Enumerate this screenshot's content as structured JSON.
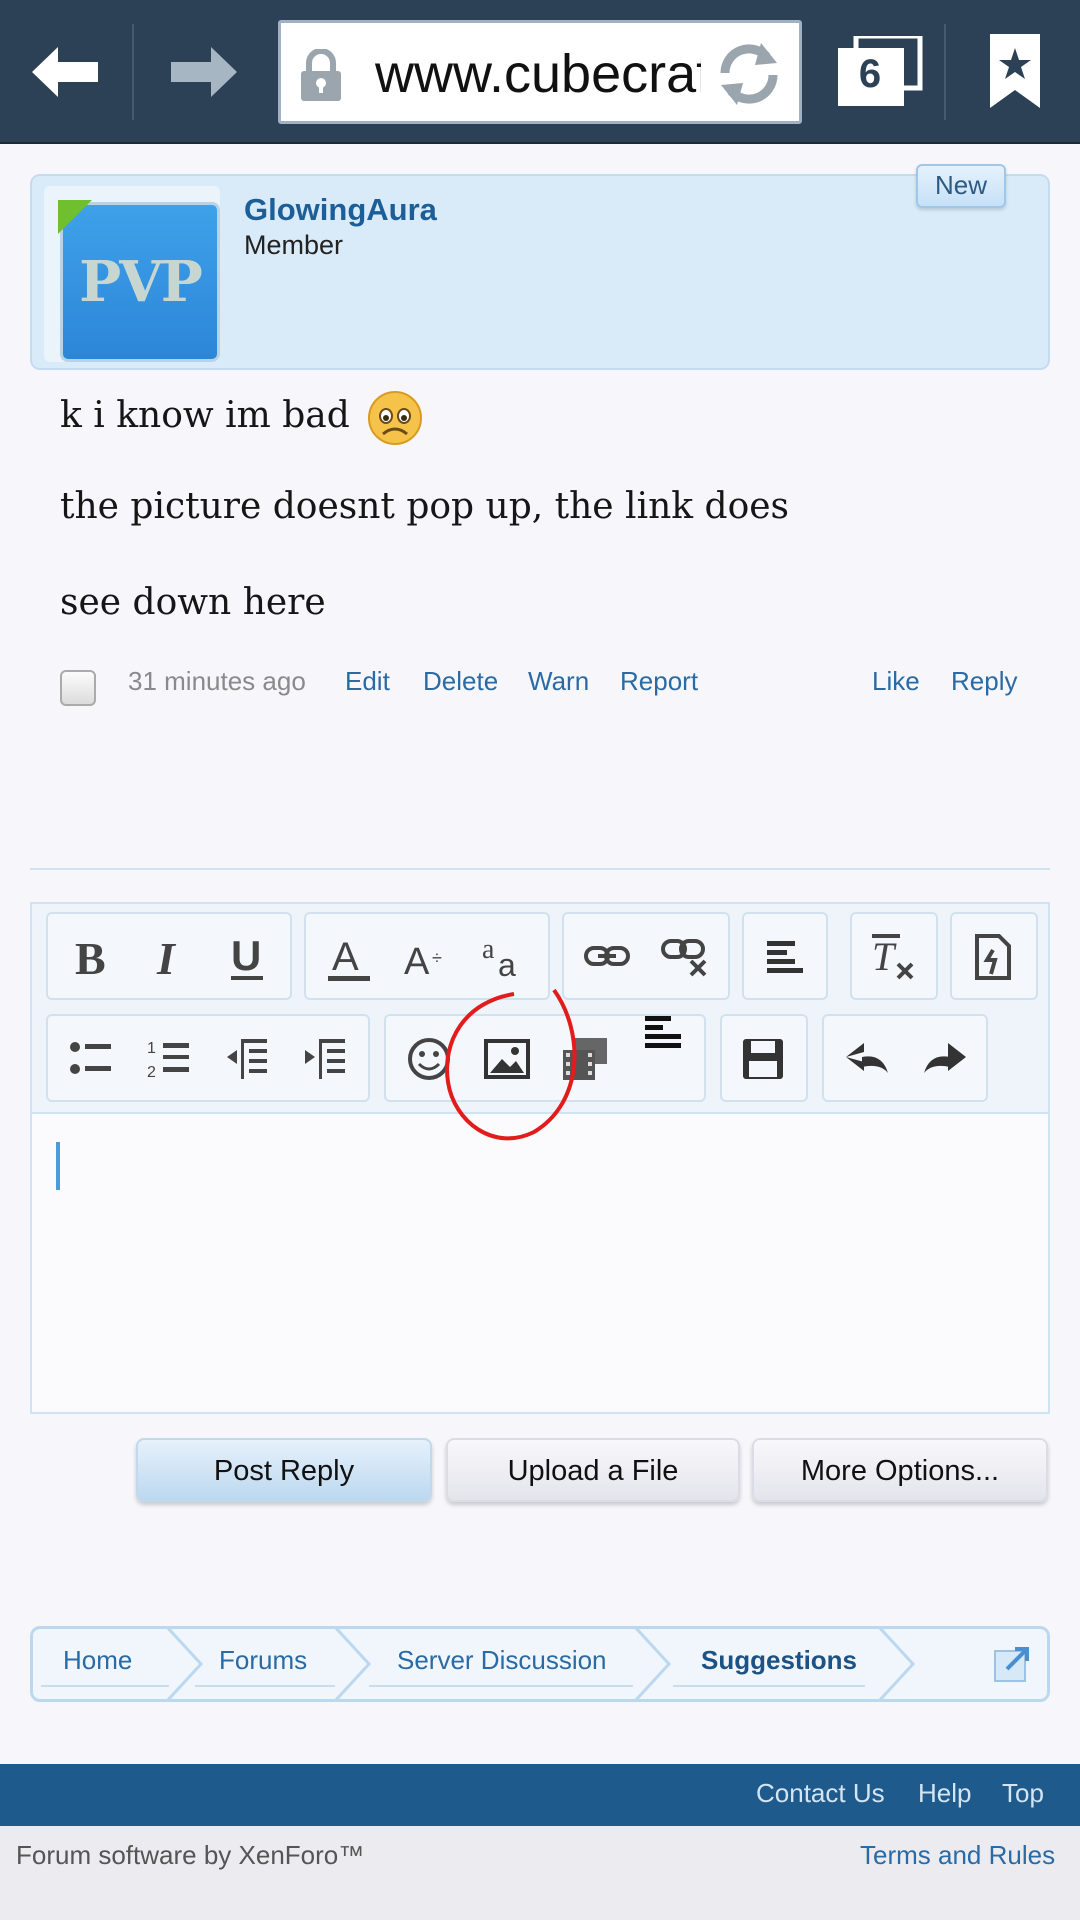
{
  "browser": {
    "url": "www.cubecraftgames.net",
    "tab_count": "6"
  },
  "post": {
    "username": "GlowingAura",
    "user_title": "Member",
    "avatar_text": "PVP",
    "new_badge": "New",
    "lines": [
      "k i know im bad",
      "the picture doesnt pop up, the link does",
      "see down here"
    ],
    "time": "31 minutes ago",
    "actions": [
      "Edit",
      "Delete",
      "Warn",
      "Report"
    ],
    "right_actions": [
      "Like",
      "Reply"
    ]
  },
  "editor": {
    "toolbar_row1": [
      "bold-icon",
      "italic-icon",
      "underline-icon",
      "font-color-icon",
      "font-size-icon",
      "font-family-icon",
      "link-icon",
      "unlink-icon",
      "align-icon",
      "remove-format-icon",
      "view-source-icon"
    ],
    "toolbar_row2": [
      "bullet-list-icon",
      "numbered-list-icon",
      "outdent-icon",
      "indent-icon",
      "smilie-icon",
      "image-icon",
      "media-icon",
      "align-more-icon",
      "save-draft-icon",
      "undo-icon",
      "redo-icon"
    ],
    "annotation_color": "#e21b1b"
  },
  "buttons": {
    "post_reply": "Post Reply",
    "upload": "Upload a File",
    "more": "More Options..."
  },
  "breadcrumb": [
    "Home",
    "Forums",
    "Server Discussion",
    "Suggestions"
  ],
  "footer": {
    "links": [
      "Contact Us",
      "Help",
      "Top"
    ],
    "credit": "Forum software by XenForo™",
    "terms": "Terms and Rules"
  }
}
